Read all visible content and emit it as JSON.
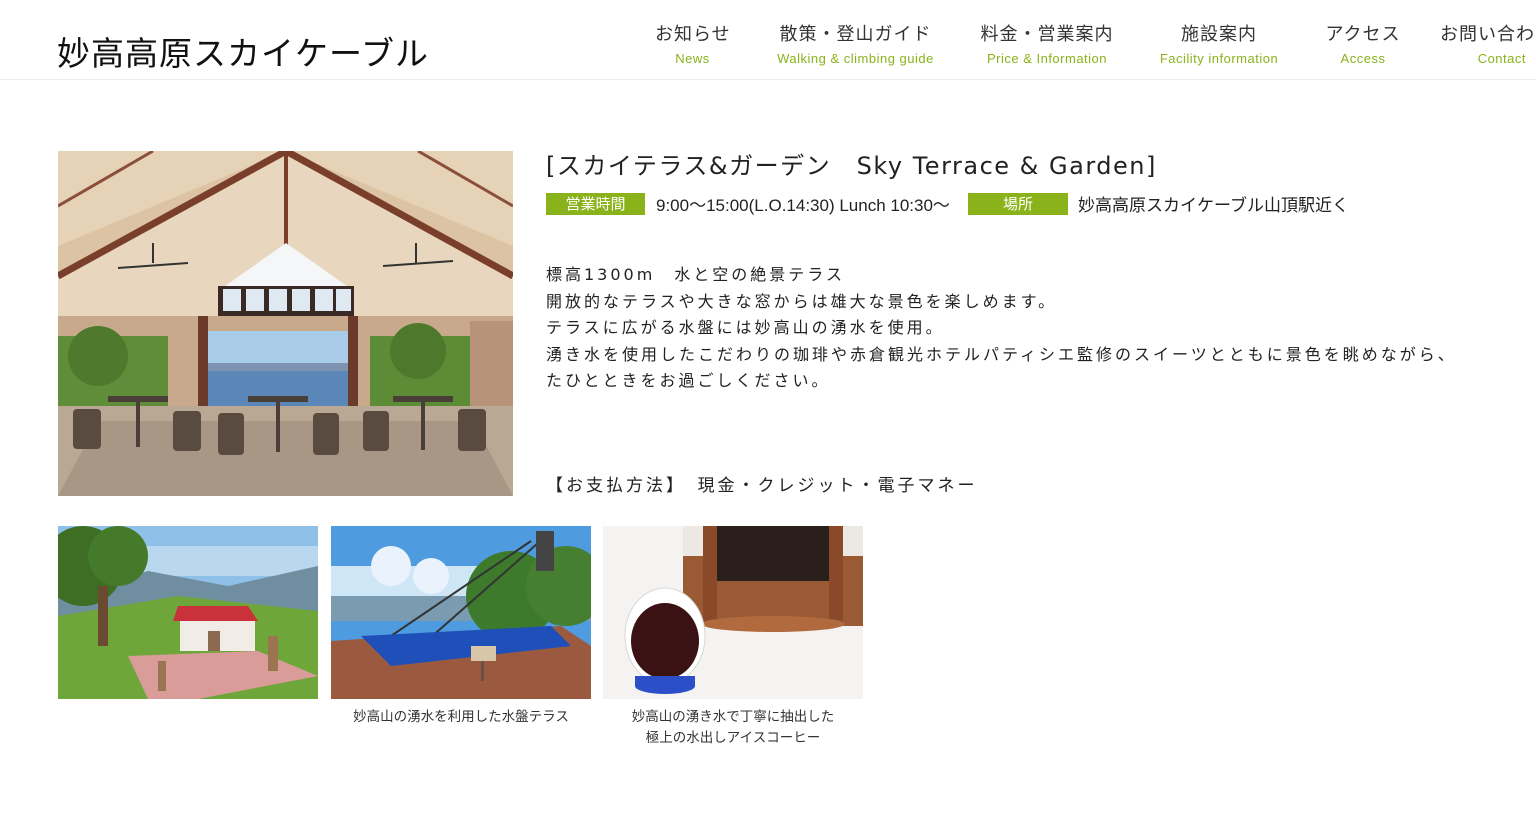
{
  "header": {
    "logo": "妙高高原スカイケーブル",
    "nav": [
      {
        "jp": "お知らせ",
        "en": "News"
      },
      {
        "jp": "散策・登山ガイド",
        "en": "Walking & climbing guide"
      },
      {
        "jp": "料金・営業案内",
        "en": "Price & Information"
      },
      {
        "jp": "施設案内",
        "en": "Facility information"
      },
      {
        "jp": "アクセス",
        "en": "Access"
      },
      {
        "jp": "お問い合わ",
        "en": "Contact"
      }
    ]
  },
  "facility": {
    "title": "[スカイテラス&ガーデン　Sky Terrace & Garden]",
    "hours_label": "営業時間",
    "hours_value": "9:00〜15:00(L.O.14:30) Lunch 10:30〜",
    "location_label": "場所",
    "location_value": "妙高高原スカイケーブル山頂駅近く",
    "description": [
      "標高1300m　水と空の絶景テラス",
      "開放的なテラスや大きな窓からは雄大な景色を楽しめます。",
      "テラスに広がる水盤には妙高山の湧水を使用。",
      "湧き水を使用したこだわりの珈琲や赤倉観光ホテルパティシエ監修のスイーツとともに景色を眺めながら、",
      "たひとときをお過ごしください。"
    ],
    "payment": "【お支払方法】　現金・クレジット・電子マネー"
  },
  "gallery": [
    {
      "caption_lines": []
    },
    {
      "caption_lines": [
        "妙高山の湧水を利用した水盤テラス"
      ]
    },
    {
      "caption_lines": [
        "妙高山の湧き水で丁寧に抽出した",
        "極上の水出しアイスコーヒー"
      ]
    }
  ],
  "colors": {
    "accent": "#8ab31b",
    "text": "#222222"
  }
}
